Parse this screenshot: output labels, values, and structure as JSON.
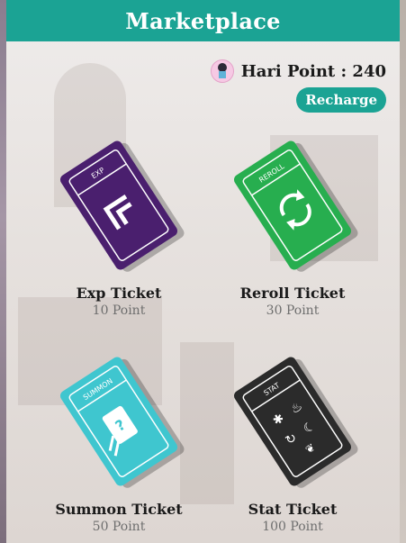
{
  "header": {
    "title": "Marketplace"
  },
  "points": {
    "label": "Hari Point : 240"
  },
  "recharge": {
    "label": "Recharge"
  },
  "colors": {
    "accent": "#1ba394",
    "exp": "#4a1f6e",
    "reroll": "#27ae4f",
    "summon": "#3fc6cf",
    "stat": "#2b2b2b"
  },
  "items": [
    {
      "name": "Exp Ticket",
      "price": "10 Point",
      "tag": "EXP",
      "icon": "double-chevron-icon"
    },
    {
      "name": "Reroll Ticket",
      "price": "30 Point",
      "tag": "REROLL",
      "icon": "refresh-icon"
    },
    {
      "name": "Summon Ticket",
      "price": "50 Point",
      "tag": "SUMMON",
      "icon": "summon-card-icon"
    },
    {
      "name": "Stat Ticket",
      "price": "100 Point",
      "tag": "STAT",
      "icon": "stat-elements-icon"
    }
  ]
}
